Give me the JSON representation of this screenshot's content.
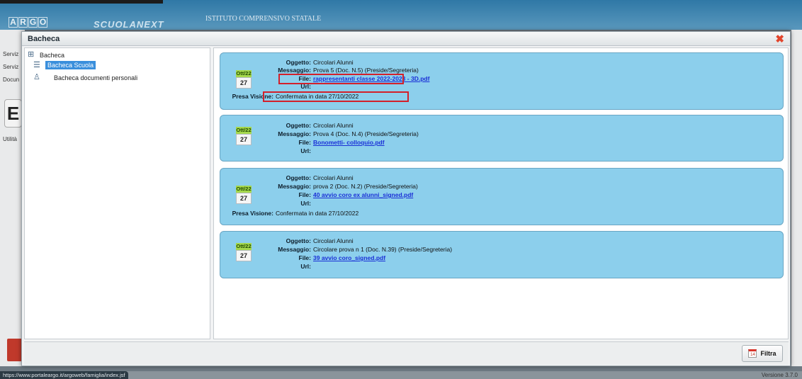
{
  "app": {
    "logo_letters": [
      "A",
      "R",
      "G",
      "O"
    ],
    "brand": "SCUOLANEXT",
    "school": "ISTITUTO COMPRENSIVO STATALE",
    "left_menu": [
      "Serviz",
      "Serviz",
      "Docun",
      "Utilità"
    ],
    "left_big_letter": "E",
    "status_url": "https://www.portaleargo.it/argoweb/famiglia/index.jsf",
    "version": "Versione 3.7.0"
  },
  "dialog": {
    "title": "Bacheca",
    "close_glyph": "✖",
    "tree": {
      "root": "Bacheca",
      "items": [
        "Bacheca Scuola",
        "Bacheca documenti personali"
      ]
    },
    "labels": {
      "oggetto": "Oggetto:",
      "messaggio": "Messaggio:",
      "file": "File:",
      "url": "Url:",
      "presa_visione": "Presa Visione:"
    },
    "cards": [
      {
        "month": "Ott/22",
        "day": "27",
        "oggetto": "Circolari Alunni",
        "messaggio": "Prova 5 (Doc. N.5) (Preside/Segreteria)",
        "file": "rappresentanti classe 2022-2023 - 3D.pdf",
        "url": "",
        "presa_visione": "Confermata in data 27/10/2022"
      },
      {
        "month": "Ott/22",
        "day": "27",
        "oggetto": "Circolari Alunni",
        "messaggio": "Prova 4 (Doc. N.4) (Preside/Segreteria)",
        "file": "Bonometti- colloquio.pdf",
        "url": ""
      },
      {
        "month": "Ott/22",
        "day": "27",
        "oggetto": "Circolari Alunni",
        "messaggio": "prova 2 (Doc. N.2) (Preside/Segreteria)",
        "file": "40 avvio coro ex alunni_signed.pdf",
        "url": "",
        "presa_visione": "Confermata in data 27/10/2022"
      },
      {
        "month": "Ott/22",
        "day": "27",
        "oggetto": "Circolari Alunni",
        "messaggio": "Circolare prova n 1 (Doc. N.39) (Preside/Segreteria)",
        "file": "39 avvio coro_signed.pdf",
        "url": ""
      }
    ],
    "filter": {
      "label": "Filtra",
      "icon_num": "14"
    }
  },
  "colors": {
    "card_bg": "#8ccfec",
    "highlight": "#d3202a",
    "link": "#1a2fd6",
    "header": "#2f78a6"
  }
}
